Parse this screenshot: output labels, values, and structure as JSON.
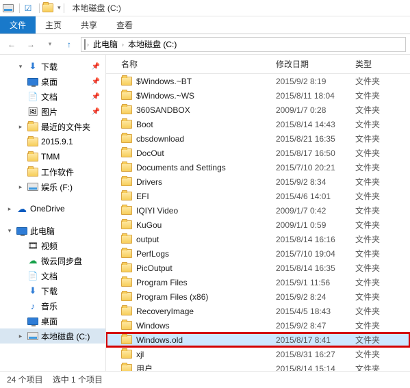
{
  "title": "本地磁盘 (C:)",
  "ribbon": {
    "file": "文件",
    "home": "主页",
    "share": "共享",
    "view": "查看"
  },
  "breadcrumb": [
    "此电脑",
    "本地磁盘 (C:)"
  ],
  "columns": {
    "name": "名称",
    "date": "修改日期",
    "type": "类型"
  },
  "sidebar": [
    {
      "label": "下载",
      "depth": 1,
      "icon": "download",
      "pin": true,
      "tw": "▾"
    },
    {
      "label": "桌面",
      "depth": 1,
      "icon": "desktop",
      "pin": true
    },
    {
      "label": "文档",
      "depth": 1,
      "icon": "doc",
      "pin": true
    },
    {
      "label": "图片",
      "depth": 1,
      "icon": "pic",
      "pin": true
    },
    {
      "label": "最近的文件夹",
      "depth": 1,
      "icon": "folder",
      "tw": "▸"
    },
    {
      "label": "2015.9.1",
      "depth": 1,
      "icon": "folder"
    },
    {
      "label": "TMM",
      "depth": 1,
      "icon": "folder"
    },
    {
      "label": "工作软件",
      "depth": 1,
      "icon": "folder"
    },
    {
      "label": "娱乐 (F:)",
      "depth": 1,
      "icon": "drive",
      "tw": "▸"
    },
    {
      "spacer": true
    },
    {
      "label": "OneDrive",
      "depth": 0,
      "icon": "cloud",
      "tw": "▸"
    },
    {
      "spacer": true
    },
    {
      "label": "此电脑",
      "depth": 0,
      "icon": "monitor",
      "tw": "▾"
    },
    {
      "label": "视频",
      "depth": 1,
      "icon": "video"
    },
    {
      "label": "微云同步盘",
      "depth": 1,
      "icon": "cloud2"
    },
    {
      "label": "文档",
      "depth": 1,
      "icon": "doc"
    },
    {
      "label": "下载",
      "depth": 1,
      "icon": "download"
    },
    {
      "label": "音乐",
      "depth": 1,
      "icon": "music"
    },
    {
      "label": "桌面",
      "depth": 1,
      "icon": "desktop"
    },
    {
      "label": "本地磁盘 (C:)",
      "depth": 1,
      "icon": "drive",
      "tw": "▸",
      "selected": true
    }
  ],
  "files": [
    {
      "name": "$Windows.~BT",
      "date": "2015/9/2 8:19",
      "type": "文件夹"
    },
    {
      "name": "$Windows.~WS",
      "date": "2015/8/11 18:04",
      "type": "文件夹"
    },
    {
      "name": "360SANDBOX",
      "date": "2009/1/7 0:28",
      "type": "文件夹"
    },
    {
      "name": "Boot",
      "date": "2015/8/14 14:43",
      "type": "文件夹"
    },
    {
      "name": "cbsdownload",
      "date": "2015/8/21 16:35",
      "type": "文件夹"
    },
    {
      "name": "DocOut",
      "date": "2015/8/17 16:50",
      "type": "文件夹"
    },
    {
      "name": "Documents and Settings",
      "date": "2015/7/10 20:21",
      "type": "文件夹"
    },
    {
      "name": "Drivers",
      "date": "2015/9/2 8:34",
      "type": "文件夹"
    },
    {
      "name": "EFI",
      "date": "2015/4/6 14:01",
      "type": "文件夹"
    },
    {
      "name": "IQIYI Video",
      "date": "2009/1/7 0:42",
      "type": "文件夹"
    },
    {
      "name": "KuGou",
      "date": "2009/1/1 0:59",
      "type": "文件夹"
    },
    {
      "name": "output",
      "date": "2015/8/14 16:16",
      "type": "文件夹"
    },
    {
      "name": "PerfLogs",
      "date": "2015/7/10 19:04",
      "type": "文件夹"
    },
    {
      "name": "PicOutput",
      "date": "2015/8/14 16:35",
      "type": "文件夹"
    },
    {
      "name": "Program Files",
      "date": "2015/9/1 11:56",
      "type": "文件夹"
    },
    {
      "name": "Program Files (x86)",
      "date": "2015/9/2 8:24",
      "type": "文件夹"
    },
    {
      "name": "RecoveryImage",
      "date": "2015/4/5 18:43",
      "type": "文件夹"
    },
    {
      "name": "Windows",
      "date": "2015/9/2 8:47",
      "type": "文件夹"
    },
    {
      "name": "Windows.old",
      "date": "2015/8/17 8:41",
      "type": "文件夹",
      "selected": true,
      "highlighted": true
    },
    {
      "name": "xjl",
      "date": "2015/8/31 16:27",
      "type": "文件夹"
    },
    {
      "name": "用户",
      "date": "2015/8/14 15:14",
      "type": "文件夹"
    }
  ],
  "status": {
    "items": "24 个项目",
    "sel": "选中 1 个项目"
  }
}
